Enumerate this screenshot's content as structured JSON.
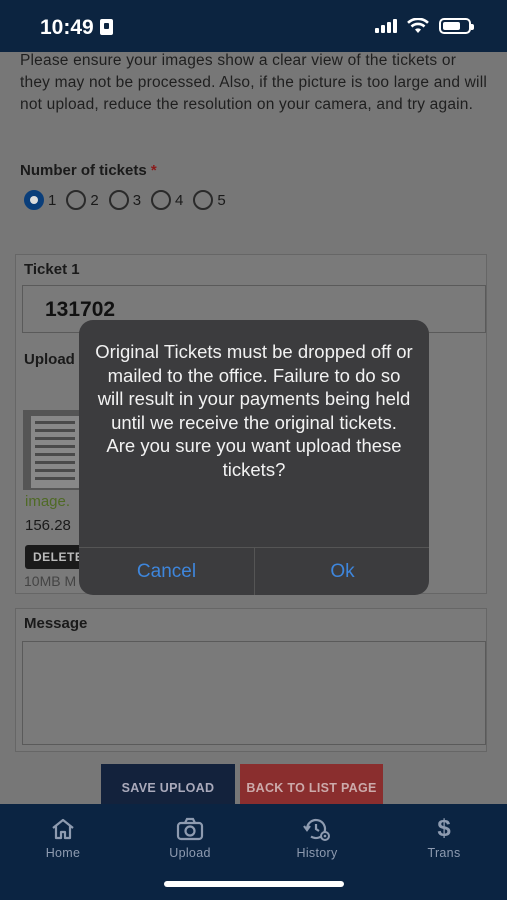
{
  "status_bar": {
    "time": "10:49"
  },
  "form": {
    "intro_text": "Please ensure your images show a clear view of the tickets or they may not be processed. Also, if the picture is too large and will not upload, reduce the resolution on your camera, and try again.",
    "count_label": "Number of tickets",
    "required_mark": "*",
    "count_options": [
      "1",
      "2",
      "3",
      "4",
      "5"
    ],
    "selected_count": "1",
    "ticket_label": "Ticket 1",
    "ticket_value": "131702",
    "upload_label": "Upload",
    "file_name": "image.",
    "file_size": "156.28",
    "delete_label": "DELETE",
    "max_note": "10MB M",
    "message_label": "Message",
    "message_value": "",
    "save_label": "SAVE UPLOAD",
    "back_label": "BACK TO LIST PAGE"
  },
  "dialog": {
    "message": "Original Tickets must be dropped off or mailed to the office. Failure to do so will result in your payments being held until we receive the original tickets.  Are you sure you want upload these tickets?",
    "cancel_label": "Cancel",
    "ok_label": "Ok",
    "button_color": "#3e86dc"
  },
  "tabbar": {
    "items": [
      {
        "label": "Home",
        "icon": "home-icon"
      },
      {
        "label": "Upload",
        "icon": "camera-icon"
      },
      {
        "label": "History",
        "icon": "history-icon"
      },
      {
        "label": "Trans",
        "icon": "dollar-icon"
      }
    ]
  },
  "colors": {
    "header_bg": "#0c2440",
    "save_button": "#13223c",
    "back_button": "#8a2e2e",
    "dialog_bg": "#3c3c3e"
  }
}
